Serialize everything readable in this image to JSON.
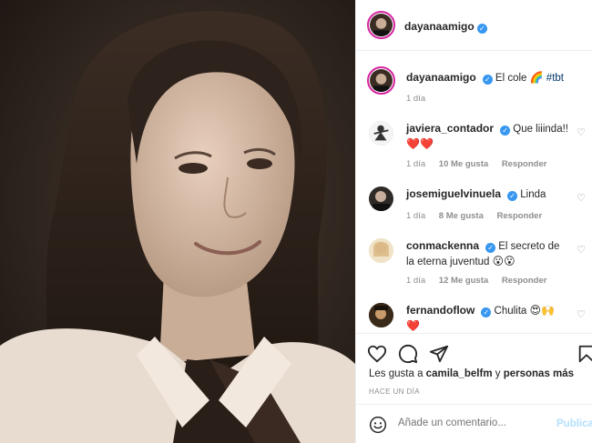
{
  "post": {
    "author": "dayanaamigo",
    "verified": true
  },
  "caption": {
    "author": "dayanaamigo",
    "text": "El cole",
    "emoji": "🌈",
    "hashtag": "#tbt",
    "time": "1 día"
  },
  "comments": [
    {
      "username": "javiera_contador",
      "verified": true,
      "text": "Que liiinda!!",
      "emoji": "❤️❤️",
      "time": "1 día",
      "likes": "10 Me gusta",
      "reply": "Responder"
    },
    {
      "username": "josemiguelvinuela",
      "verified": true,
      "text": "Linda",
      "emoji": "",
      "time": "1 día",
      "likes": "8 Me gusta",
      "reply": "Responder"
    },
    {
      "username": "conmackenna",
      "verified": true,
      "text": "El secreto de la eterna juventud",
      "emoji": "😮😮",
      "time": "1 día",
      "likes": "12 Me gusta",
      "reply": "Responder"
    },
    {
      "username": "fernandoflow",
      "verified": true,
      "text": "Chulita",
      "emoji": "😍🙌",
      "emoji2": "❤️"
    }
  ],
  "likes": {
    "prefix": "Les gusta a",
    "user": "camila_belfm",
    "connector": "y",
    "others": "personas más"
  },
  "time_ago": "HACE UN DÍA",
  "add_comment": {
    "placeholder": "Añade un comentario...",
    "publish": "Publicar"
  },
  "colors": {
    "accent_blue": "#3897f0",
    "publish_disabled": "#b2dffc",
    "muted": "#8e8e8e",
    "heart_red": "#ed4956"
  },
  "icons": [
    "heart-icon",
    "comment-icon",
    "share-icon",
    "bookmark-icon",
    "smile-icon",
    "verified-icon"
  ]
}
